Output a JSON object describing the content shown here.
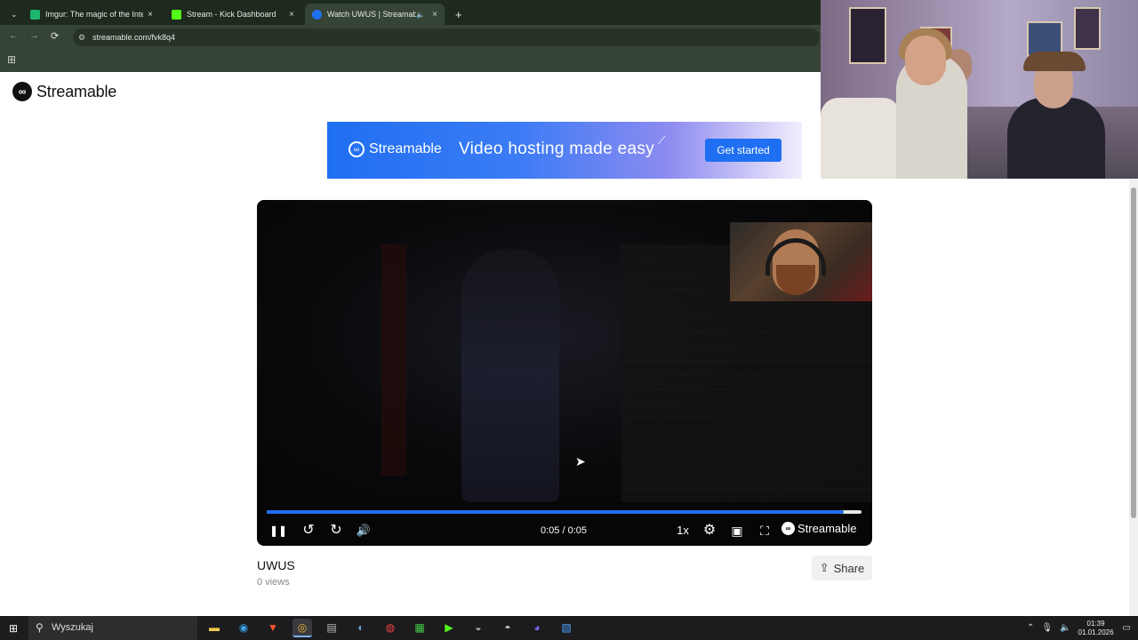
{
  "browser": {
    "tabs": [
      {
        "title": "Imgur: The magic of the Internet",
        "favicon_color": "#1bb76e"
      },
      {
        "title": "Stream - Kick Dashboard",
        "favicon_color": "#53fc18"
      },
      {
        "title": "Watch UWUS | Streamable",
        "favicon_color": "#1f6ff2"
      }
    ],
    "url": "streamable.com/fvk8q4",
    "new_tab": "+",
    "close": "×",
    "back": "←",
    "forward": "→",
    "reload": "⟳",
    "apps": "⊞",
    "tune": "⚙",
    "tab_menu": "⌄",
    "mute": "🔈"
  },
  "page": {
    "brand_name": "Streamable",
    "banner": {
      "brand": "Streamable",
      "tagline": "Video hosting made easy",
      "cta": "Get started"
    },
    "player": {
      "time": "0:05 / 0:05",
      "speed": "1x",
      "brand": "Streamable",
      "progress": 0.97,
      "icons": {
        "pause": "❚❚",
        "rewind": "↺",
        "forward": "↻",
        "volume": "🔊",
        "settings": "⚙",
        "pip": "▣",
        "fullscreen": "⛶"
      }
    },
    "video_title": "UWUS",
    "views": "0 views",
    "share": "Share",
    "share_icon": "⇪"
  },
  "taskbar": {
    "search_placeholder": "Wyszukaj",
    "time": "01:39",
    "date": "01.01.2026",
    "apps": [
      "explorer",
      "edge",
      "brave",
      "chrome",
      "app-5",
      "steam",
      "app-7",
      "app-8",
      "app-9",
      "app-10",
      "app-11",
      "app-12",
      "app-13"
    ]
  },
  "colors": {
    "accent": "#1f6ff2",
    "chrome_dark": "#1d2a1d",
    "chrome_toolbar": "#354434"
  }
}
